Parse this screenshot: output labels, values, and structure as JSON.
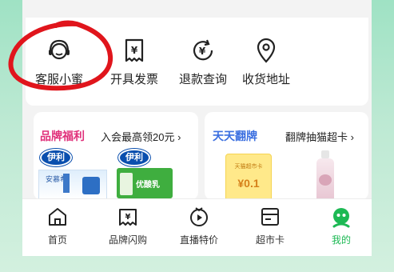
{
  "services": [
    {
      "label": "客服小蜜",
      "icon": "customer-service-icon"
    },
    {
      "label": "开具发票",
      "icon": "invoice-icon"
    },
    {
      "label": "退款查询",
      "icon": "refund-icon"
    },
    {
      "label": "收货地址",
      "icon": "location-icon"
    }
  ],
  "promo_left": {
    "title": "品牌福利",
    "subtitle": "入会最高领20元 ›",
    "brand": "伊利",
    "product_text": "安慕希",
    "product_text_2": "优酸乳"
  },
  "promo_right": {
    "title": "天天翻牌",
    "subtitle": "翻牌抽猫超卡 ›",
    "card_label": "天猫超市卡",
    "card_value": "¥0.1"
  },
  "tabs": [
    {
      "label": "首页",
      "icon": "home-icon"
    },
    {
      "label": "品牌闪购",
      "icon": "flash-sale-icon"
    },
    {
      "label": "直播特价",
      "icon": "live-icon"
    },
    {
      "label": "超市卡",
      "icon": "card-icon"
    },
    {
      "label": "我的",
      "icon": "profile-icon",
      "active": true
    }
  ],
  "colors": {
    "accent_green": "#1db954",
    "promo_pink": "#e0307a",
    "promo_blue": "#3b6fe0",
    "annotation_red": "#e0151c"
  }
}
